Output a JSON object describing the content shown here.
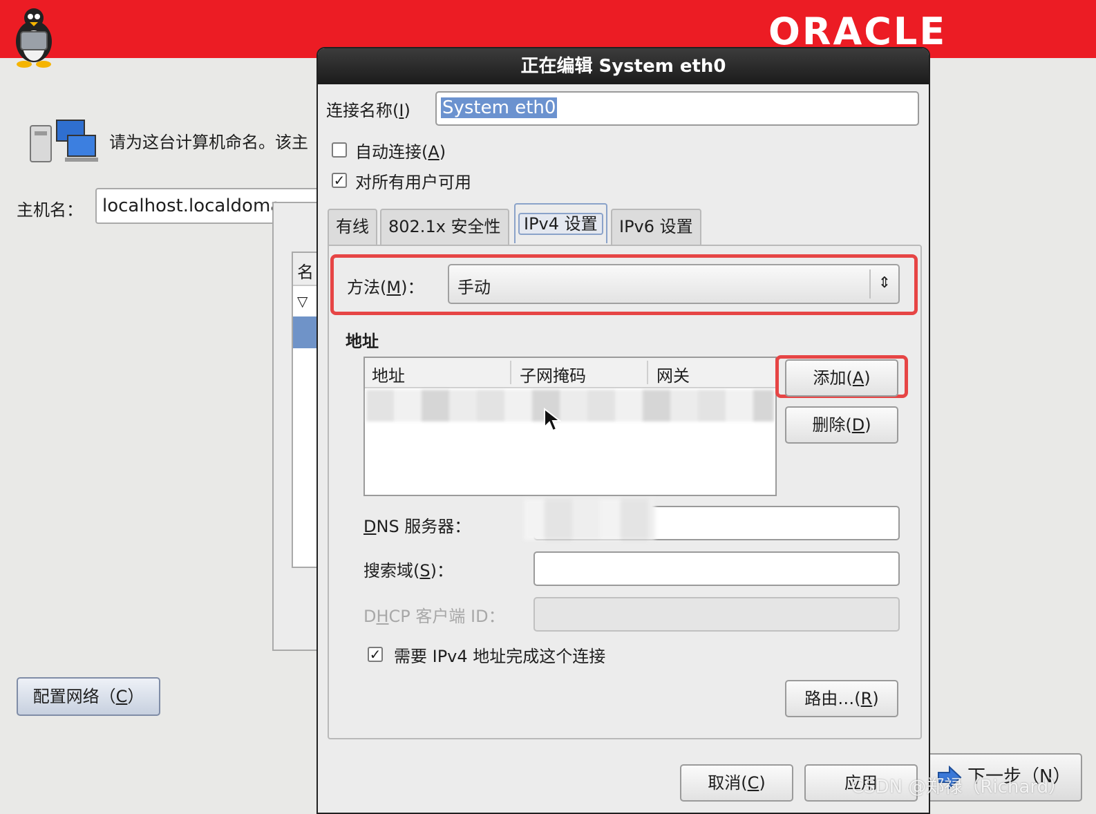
{
  "background": {
    "brand": "ORACLE",
    "brand_color": "#ec1c24",
    "prompt": "请为这台计算机命名。该主",
    "hostname_label": "主机名：",
    "hostname_value": "localhost.localdoma",
    "list_header": "名",
    "configure_network_button": {
      "text": "配置网络（",
      "mnemonic": "C",
      "suffix": "）"
    },
    "next_button": "下一步（N）",
    "icons": {
      "tux": "tux-penguin-icon",
      "computer": "network-computer-icon",
      "next": "arrow-right-icon"
    }
  },
  "dialog": {
    "title": "正在编辑 System eth0",
    "connection_name_label": {
      "text": "连接名称(",
      "mnemonic": "I",
      "suffix": ")"
    },
    "connection_name_value": "System eth0",
    "auto_connect": {
      "text": "自动连接(",
      "mnemonic": "A",
      "suffix": ")",
      "checked": false
    },
    "all_users": {
      "label": "对所有用户可用",
      "checked": true
    },
    "tabs": [
      {
        "label": "有线",
        "active": false
      },
      {
        "label": "802.1x 安全性",
        "active": false
      },
      {
        "label": "IPv4 设置",
        "active": true
      },
      {
        "label": "IPv6 设置",
        "active": false
      }
    ],
    "method": {
      "label": "方法(",
      "mnemonic": "M",
      "suffix": ")：",
      "value": "手动"
    },
    "address_section_title": "地址",
    "address_columns": [
      "地址",
      "子网掩码",
      "网关"
    ],
    "add_button": {
      "text": "添加(",
      "mnemonic": "A",
      "suffix": ")"
    },
    "delete_button": {
      "text": "删除(",
      "mnemonic": "D",
      "suffix": ")"
    },
    "dns_label": {
      "mnemonic": "D",
      "text": "NS 服务器："
    },
    "search_domain_label": {
      "text": "搜索域(",
      "mnemonic": "S",
      "suffix": ")："
    },
    "dhcp_client_id_label": {
      "prefix": "D",
      "mnemonic": "H",
      "text": "CP 客户端 ID："
    },
    "require_ipv4": {
      "label": "需要 IPv4 地址完成这个连接",
      "checked": true
    },
    "routes_button": {
      "text": "路由…(",
      "mnemonic": "R",
      "suffix": ")"
    },
    "cancel_button": {
      "text": "取消(",
      "mnemonic": "C",
      "suffix": ")"
    },
    "apply_button": "应用",
    "highlight_color": "#e64545"
  },
  "watermark": "CSDN @郑禄（Richard）"
}
